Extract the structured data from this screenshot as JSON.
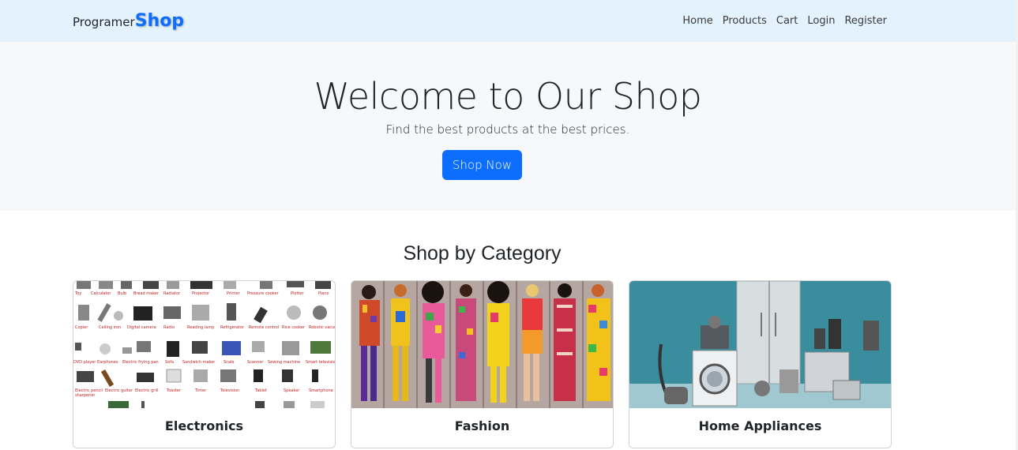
{
  "navbar": {
    "brand_first": "Programer",
    "brand_second": "Shop",
    "brand_color": "#0d6efd",
    "background": "#e3f2fd",
    "links": [
      "Home",
      "Products",
      "Cart",
      "Login",
      "Register"
    ]
  },
  "hero": {
    "title": "Welcome to Our Shop",
    "subtitle": "Find the best products at the best prices.",
    "button_label": "Shop Now"
  },
  "categories": {
    "title": "Shop by Category",
    "items": [
      {
        "label": "Electronics",
        "image": "electronics-collage"
      },
      {
        "label": "Fashion",
        "image": "fashion-models"
      },
      {
        "label": "Home Appliances",
        "image": "home-appliances"
      }
    ]
  }
}
